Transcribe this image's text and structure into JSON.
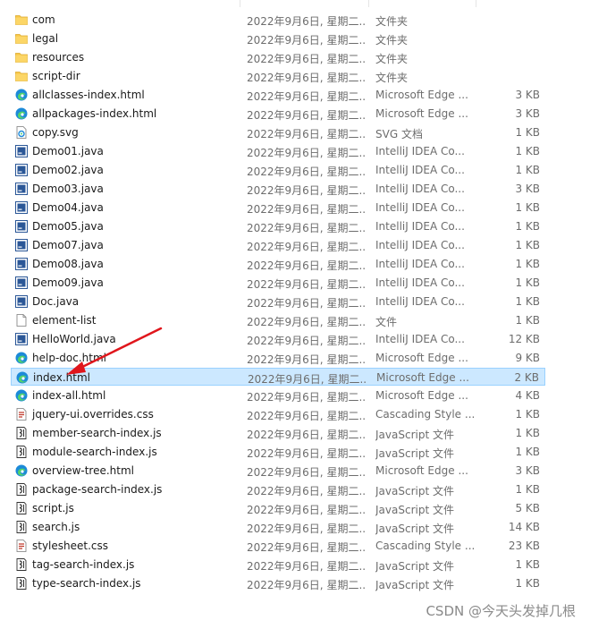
{
  "files": [
    {
      "name": "com",
      "date": "2022年9月6日, 星期二...",
      "type": "文件夹",
      "size": "",
      "icon": "folder-icon"
    },
    {
      "name": "legal",
      "date": "2022年9月6日, 星期二...",
      "type": "文件夹",
      "size": "",
      "icon": "folder-icon"
    },
    {
      "name": "resources",
      "date": "2022年9月6日, 星期二...",
      "type": "文件夹",
      "size": "",
      "icon": "folder-icon"
    },
    {
      "name": "script-dir",
      "date": "2022年9月6日, 星期二...",
      "type": "文件夹",
      "size": "",
      "icon": "folder-icon"
    },
    {
      "name": "allclasses-index.html",
      "date": "2022年9月6日, 星期二...",
      "type": "Microsoft Edge ...",
      "size": "3 KB",
      "icon": "edge-icon"
    },
    {
      "name": "allpackages-index.html",
      "date": "2022年9月6日, 星期二...",
      "type": "Microsoft Edge ...",
      "size": "3 KB",
      "icon": "edge-icon"
    },
    {
      "name": "copy.svg",
      "date": "2022年9月6日, 星期二...",
      "type": "SVG 文档",
      "size": "1 KB",
      "icon": "svg-file-icon"
    },
    {
      "name": "Demo01.java",
      "date": "2022年9月6日, 星期二...",
      "type": "IntelliJ IDEA Co...",
      "size": "1 KB",
      "icon": "java-file-icon"
    },
    {
      "name": "Demo02.java",
      "date": "2022年9月6日, 星期二...",
      "type": "IntelliJ IDEA Co...",
      "size": "1 KB",
      "icon": "java-file-icon"
    },
    {
      "name": "Demo03.java",
      "date": "2022年9月6日, 星期二...",
      "type": "IntelliJ IDEA Co...",
      "size": "3 KB",
      "icon": "java-file-icon"
    },
    {
      "name": "Demo04.java",
      "date": "2022年9月6日, 星期二...",
      "type": "IntelliJ IDEA Co...",
      "size": "1 KB",
      "icon": "java-file-icon"
    },
    {
      "name": "Demo05.java",
      "date": "2022年9月6日, 星期二...",
      "type": "IntelliJ IDEA Co...",
      "size": "1 KB",
      "icon": "java-file-icon"
    },
    {
      "name": "Demo07.java",
      "date": "2022年9月6日, 星期二...",
      "type": "IntelliJ IDEA Co...",
      "size": "1 KB",
      "icon": "java-file-icon"
    },
    {
      "name": "Demo08.java",
      "date": "2022年9月6日, 星期二...",
      "type": "IntelliJ IDEA Co...",
      "size": "1 KB",
      "icon": "java-file-icon"
    },
    {
      "name": "Demo09.java",
      "date": "2022年9月6日, 星期二...",
      "type": "IntelliJ IDEA Co...",
      "size": "1 KB",
      "icon": "java-file-icon"
    },
    {
      "name": "Doc.java",
      "date": "2022年9月6日, 星期二...",
      "type": "IntelliJ IDEA Co...",
      "size": "1 KB",
      "icon": "java-file-icon"
    },
    {
      "name": "element-list",
      "date": "2022年9月6日, 星期二...",
      "type": "文件",
      "size": "1 KB",
      "icon": "blank-file-icon"
    },
    {
      "name": "HelloWorld.java",
      "date": "2022年9月6日, 星期二...",
      "type": "IntelliJ IDEA Co...",
      "size": "12 KB",
      "icon": "java-file-icon"
    },
    {
      "name": "help-doc.html",
      "date": "2022年9月6日, 星期二...",
      "type": "Microsoft Edge ...",
      "size": "9 KB",
      "icon": "edge-icon"
    },
    {
      "name": "index.html",
      "date": "2022年9月6日, 星期二...",
      "type": "Microsoft Edge ...",
      "size": "2 KB",
      "icon": "edge-icon",
      "selected": true
    },
    {
      "name": "index-all.html",
      "date": "2022年9月6日, 星期二...",
      "type": "Microsoft Edge ...",
      "size": "4 KB",
      "icon": "edge-icon"
    },
    {
      "name": "jquery-ui.overrides.css",
      "date": "2022年9月6日, 星期二...",
      "type": "Cascading Style ...",
      "size": "1 KB",
      "icon": "css-file-icon"
    },
    {
      "name": "member-search-index.js",
      "date": "2022年9月6日, 星期二...",
      "type": "JavaScript 文件",
      "size": "1 KB",
      "icon": "js-file-icon"
    },
    {
      "name": "module-search-index.js",
      "date": "2022年9月6日, 星期二...",
      "type": "JavaScript 文件",
      "size": "1 KB",
      "icon": "js-file-icon"
    },
    {
      "name": "overview-tree.html",
      "date": "2022年9月6日, 星期二...",
      "type": "Microsoft Edge ...",
      "size": "3 KB",
      "icon": "edge-icon"
    },
    {
      "name": "package-search-index.js",
      "date": "2022年9月6日, 星期二...",
      "type": "JavaScript 文件",
      "size": "1 KB",
      "icon": "js-file-icon"
    },
    {
      "name": "script.js",
      "date": "2022年9月6日, 星期二...",
      "type": "JavaScript 文件",
      "size": "5 KB",
      "icon": "js-file-icon"
    },
    {
      "name": "search.js",
      "date": "2022年9月6日, 星期二...",
      "type": "JavaScript 文件",
      "size": "14 KB",
      "icon": "js-file-icon"
    },
    {
      "name": "stylesheet.css",
      "date": "2022年9月6日, 星期二...",
      "type": "Cascading Style ...",
      "size": "23 KB",
      "icon": "css-file-icon"
    },
    {
      "name": "tag-search-index.js",
      "date": "2022年9月6日, 星期二...",
      "type": "JavaScript 文件",
      "size": "1 KB",
      "icon": "js-file-icon"
    },
    {
      "name": "type-search-index.js",
      "date": "2022年9月6日, 星期二...",
      "type": "JavaScript 文件",
      "size": "1 KB",
      "icon": "js-file-icon"
    }
  ],
  "watermark": "CSDN @今天头发掉几根",
  "colors": {
    "selection_bg": "#cce8ff",
    "selection_border": "#99d1ff",
    "arrow": "#e0161c",
    "folder": "#f8c747",
    "edge": "#1c8ad8"
  },
  "annotation": {
    "icon": "red-arrow-icon",
    "points_to": "index.html"
  }
}
